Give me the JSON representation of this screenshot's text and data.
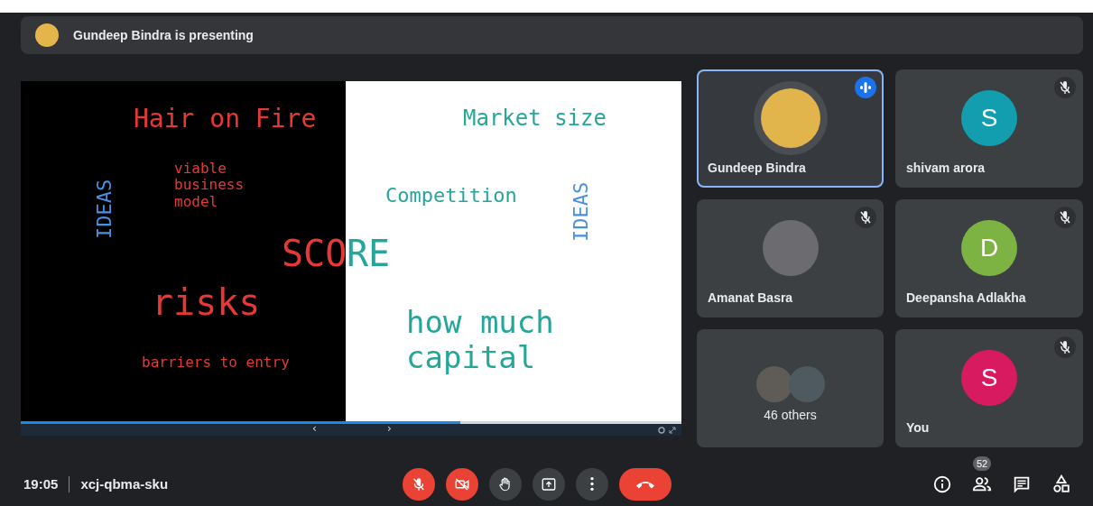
{
  "presenter_bar": {
    "text": "Gundeep Bindra is presenting"
  },
  "slide": {
    "words": [
      {
        "text": "Hair on Fire",
        "color": "#e53935",
        "kind": "horizontal"
      },
      {
        "text": "viable business model",
        "color": "#e53935",
        "kind": "horizontal"
      },
      {
        "text": "IDEAS",
        "color": "#4a90e2",
        "kind": "vertical"
      },
      {
        "text": "SCO",
        "color": "#e53935",
        "kind": "horizontal"
      },
      {
        "text": "RE",
        "color": "#26a69a",
        "kind": "horizontal"
      },
      {
        "text": "risks",
        "color": "#e53935",
        "kind": "horizontal"
      },
      {
        "text": "barriers to entry",
        "color": "#e53935",
        "kind": "horizontal"
      },
      {
        "text": "Market size",
        "color": "#26a69a",
        "kind": "horizontal"
      },
      {
        "text": "Competition",
        "color": "#26a69a",
        "kind": "horizontal"
      },
      {
        "text": "IDEAS",
        "color": "#4a90e2",
        "kind": "vertical"
      },
      {
        "text": "how much capital",
        "color": "#26a69a",
        "kind": "horizontal"
      }
    ],
    "progress": {
      "level": 0.665
    },
    "prev": "‹",
    "next": "›"
  },
  "tiles": [
    {
      "kind": "person",
      "name": "Gundeep Bindra",
      "muted": false,
      "speaking": true,
      "selected": true
    },
    {
      "kind": "person",
      "name": "shivam arora",
      "letter": "S",
      "color": "#129eaf",
      "muted": true,
      "speaking": false,
      "selected": false
    },
    {
      "kind": "person",
      "name": "Amanat Basra",
      "muted": true,
      "speaking": false,
      "selected": false
    },
    {
      "kind": "person",
      "name": "Deepansha Adlakha",
      "letter": "D",
      "color": "#7cb342",
      "muted": true,
      "speaking": false,
      "selected": false
    },
    {
      "kind": "group",
      "name": "46 others",
      "muted": false,
      "speaking": false,
      "selected": false
    },
    {
      "kind": "person",
      "name": "You",
      "letter": "S",
      "color": "#d81b60",
      "muted": true,
      "speaking": false,
      "selected": false
    }
  ],
  "meeting": {
    "time": "19:05",
    "code": "xcj-qbma-sku"
  },
  "controls": [
    {
      "kind": "mic",
      "on": false
    },
    {
      "kind": "camera",
      "on": false
    },
    {
      "kind": "hand",
      "on": false
    },
    {
      "kind": "present",
      "on": false
    },
    {
      "kind": "more",
      "on": false
    },
    {
      "kind": "leave"
    }
  ],
  "side_buttons": [
    {
      "kind": "info"
    },
    {
      "kind": "people",
      "badge": "52"
    },
    {
      "kind": "chat"
    },
    {
      "kind": "activities"
    }
  ]
}
